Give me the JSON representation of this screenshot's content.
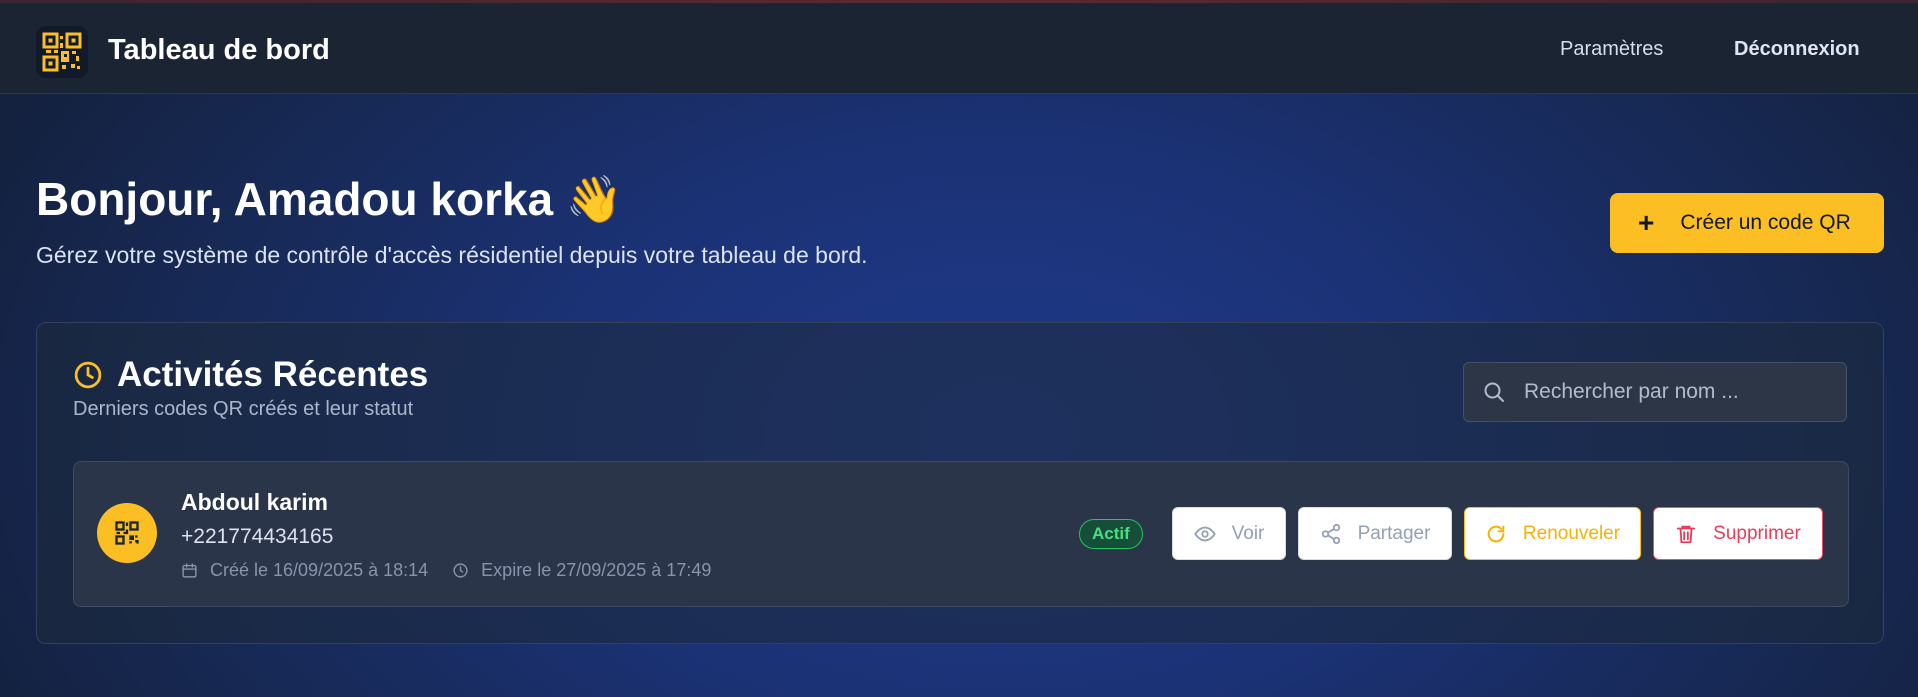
{
  "header": {
    "app_title": "Tableau de bord",
    "nav": {
      "settings": "Paramètres",
      "logout": "Déconnexion"
    }
  },
  "hero": {
    "greeting": "Bonjour, Amadou korka 👋",
    "subtitle": "Gérez votre système de contrôle d'accès résidentiel depuis votre tableau de bord.",
    "create_button": "Créer un code QR"
  },
  "activity": {
    "title": "Activités Récentes",
    "subtitle": "Derniers codes QR créés et leur statut",
    "search_placeholder": "Rechercher par nom ...",
    "items": [
      {
        "name": "Abdoul karim",
        "phone": "+221774434165",
        "created": "Créé le 16/09/2025 à 18:14",
        "expires": "Expire le 27/09/2025 à 17:49",
        "status": "Actif",
        "actions": {
          "view": "Voir",
          "share": "Partager",
          "renew": "Renouveler",
          "delete": "Supprimer"
        }
      }
    ]
  },
  "colors": {
    "accent": "#fbbf24",
    "header_bg": "#1b2433",
    "status_active": "#4ade80",
    "danger": "#e53e5a"
  },
  "icons": {
    "logo": "qr-code-icon",
    "create": "plus-icon",
    "panel": "clock-icon",
    "search": "search-icon",
    "avatar": "qr-code-icon",
    "created": "calendar-icon",
    "expires": "clock-icon",
    "view": "eye-icon",
    "share": "share-icon",
    "renew": "refresh-icon",
    "delete": "trash-icon"
  }
}
